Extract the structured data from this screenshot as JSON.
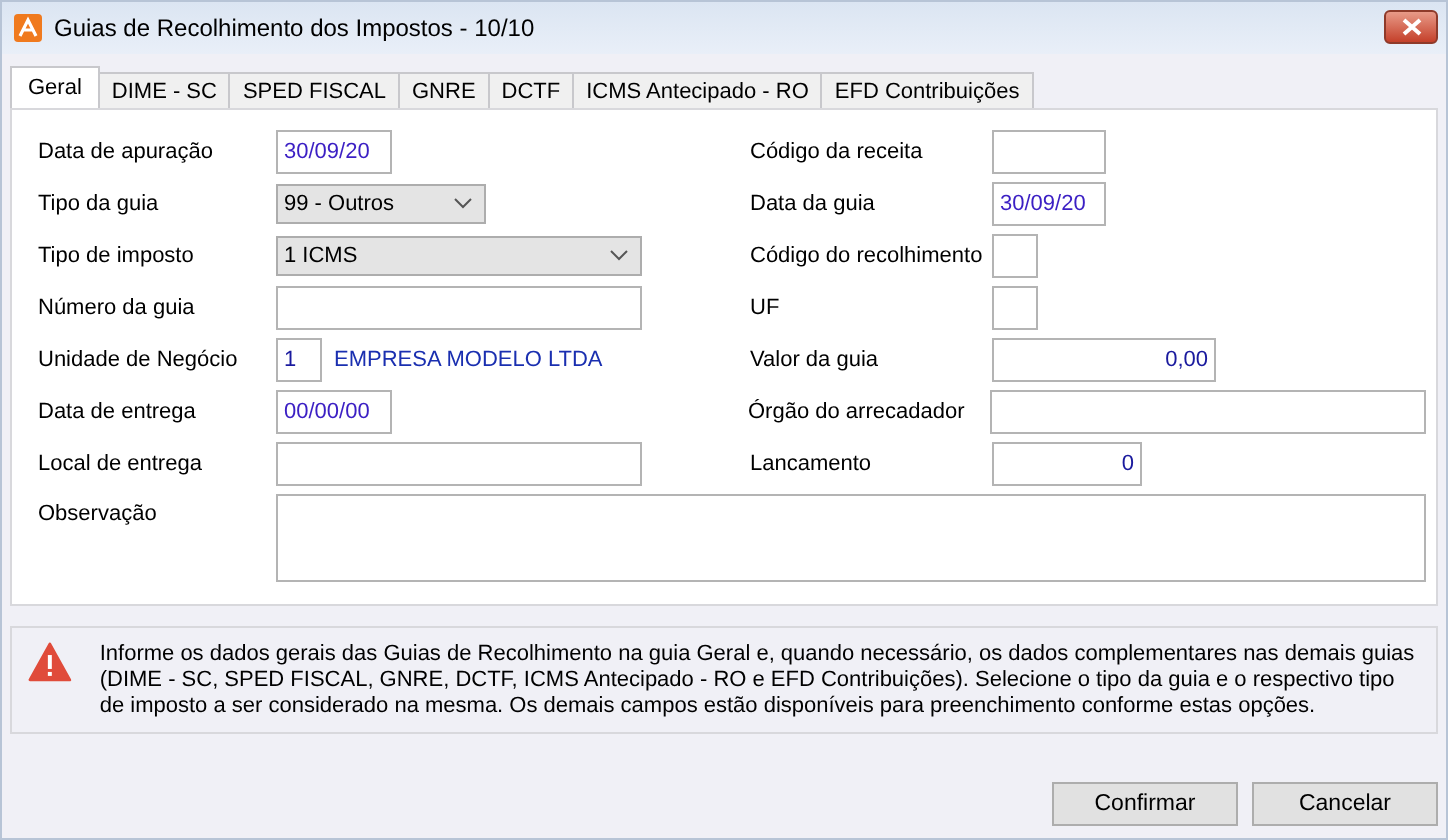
{
  "window": {
    "title": "Guias de Recolhimento dos Impostos - 10/10"
  },
  "tabs": [
    {
      "label": "Geral",
      "selected": true
    },
    {
      "label": "DIME - SC",
      "selected": false
    },
    {
      "label": "SPED FISCAL",
      "selected": false
    },
    {
      "label": "GNRE",
      "selected": false
    },
    {
      "label": "DCTF",
      "selected": false
    },
    {
      "label": "ICMS Antecipado - RO",
      "selected": false
    },
    {
      "label": "EFD Contribuições",
      "selected": false
    }
  ],
  "left_fields": [
    {
      "label": "Data de apuração",
      "kind": "date",
      "value": "30/09/20"
    },
    {
      "label": "Tipo da guia",
      "kind": "select",
      "value": "99 - Outros"
    },
    {
      "label": "Tipo de imposto",
      "kind": "select",
      "value": "1 ICMS"
    },
    {
      "label": "Número da guia",
      "kind": "text"
    },
    {
      "label": "Unidade de Negócio",
      "kind": "unit",
      "value": "1",
      "description": "EMPRESA MODELO LTDA"
    },
    {
      "label": "Data de entrega",
      "kind": "date",
      "value": "00/00/00"
    },
    {
      "label": "Local de entrega",
      "kind": "text"
    }
  ],
  "right_fields": [
    {
      "label": "Código da receita",
      "kind": "text"
    },
    {
      "label": "Data da guia",
      "kind": "date",
      "value": "30/09/20"
    },
    {
      "label": "Código do recolhimento",
      "kind": "text"
    },
    {
      "label": "UF",
      "kind": "text"
    },
    {
      "label": "Valor da guia",
      "kind": "number",
      "value": "0,00"
    },
    {
      "label": "Órgão do arrecadador",
      "kind": "text"
    },
    {
      "label": "Lancamento",
      "kind": "number",
      "value": "0"
    }
  ],
  "observation": {
    "label": "Observação"
  },
  "info": {
    "text": "Informe os dados gerais das Guias de Recolhimento na guia Geral e, quando necessário, os dados complementares nas demais guias (DIME - SC, SPED FISCAL, GNRE, DCTF, ICMS Antecipado - RO e EFD Contribuições). Selecione o tipo da guia e o respectivo tipo de imposto a ser considerado na mesma. Os demais campos estão disponíveis para preenchimento conforme estas opções."
  },
  "buttons": [
    "Confirmar",
    "Cancelar"
  ]
}
